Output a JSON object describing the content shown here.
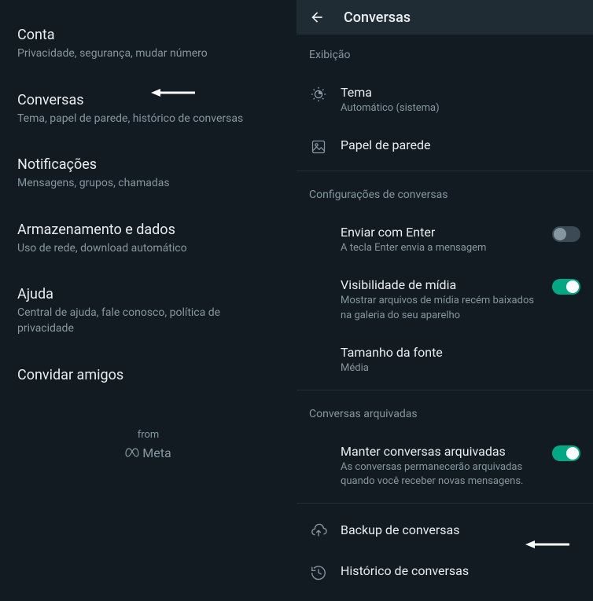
{
  "leftPanel": {
    "items": [
      {
        "title": "Conta",
        "subtitle": "Privacidade, segurança, mudar número"
      },
      {
        "title": "Conversas",
        "subtitle": "Tema, papel de parede, histórico de conversas"
      },
      {
        "title": "Notificações",
        "subtitle": "Mensagens, grupos, chamadas"
      },
      {
        "title": "Armazenamento e dados",
        "subtitle": "Uso de rede, download automático"
      },
      {
        "title": "Ajuda",
        "subtitle": "Central de ajuda, fale conosco, política de privacidade"
      },
      {
        "title": "Convidar amigos",
        "subtitle": ""
      }
    ],
    "fromLabel": "from",
    "metaLabel": "Meta"
  },
  "rightPanel": {
    "headerTitle": "Conversas",
    "sections": {
      "display": {
        "header": "Exibição",
        "theme": {
          "label": "Tema",
          "value": "Automático (sistema)"
        },
        "wallpaper": {
          "label": "Papel de parede"
        }
      },
      "chatSettings": {
        "header": "Configurações de conversas",
        "enterSend": {
          "label": "Enviar com Enter",
          "desc": "A tecla Enter envia a mensagem",
          "enabled": false
        },
        "mediaVisibility": {
          "label": "Visibilidade de mídia",
          "desc": "Mostrar arquivos de mídia recém baixados na galeria do seu aparelho",
          "enabled": true
        },
        "fontSize": {
          "label": "Tamanho da fonte",
          "value": "Média"
        }
      },
      "archived": {
        "header": "Conversas arquivadas",
        "keepArchived": {
          "label": "Manter conversas arquivadas",
          "desc": "As conversas permanecerão arquivadas quando você receber novas mensagens.",
          "enabled": true
        }
      },
      "bottom": {
        "backup": {
          "label": "Backup de conversas"
        },
        "history": {
          "label": "Histórico de conversas"
        }
      }
    }
  }
}
